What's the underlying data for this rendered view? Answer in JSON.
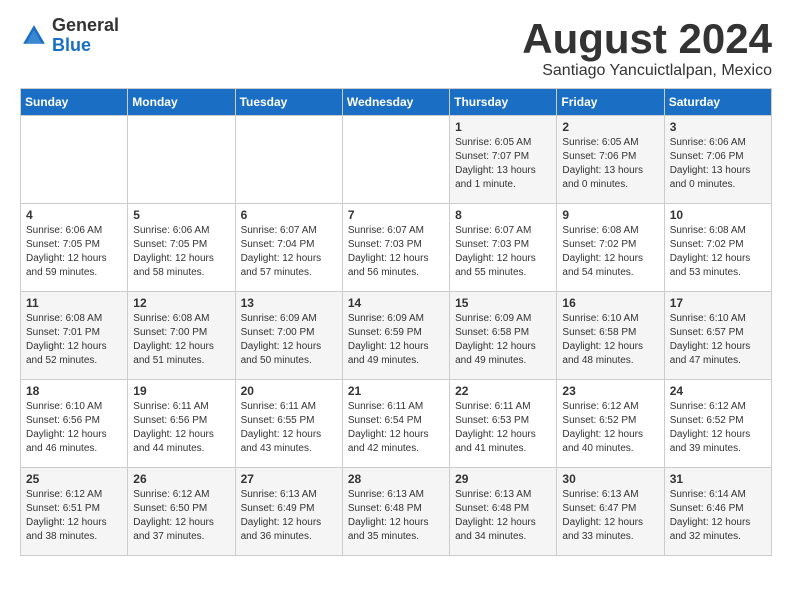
{
  "header": {
    "logo_general": "General",
    "logo_blue": "Blue",
    "month_title": "August 2024",
    "location": "Santiago Yancuictlalpan, Mexico"
  },
  "weekdays": [
    "Sunday",
    "Monday",
    "Tuesday",
    "Wednesday",
    "Thursday",
    "Friday",
    "Saturday"
  ],
  "weeks": [
    [
      {
        "day": "",
        "info": ""
      },
      {
        "day": "",
        "info": ""
      },
      {
        "day": "",
        "info": ""
      },
      {
        "day": "",
        "info": ""
      },
      {
        "day": "1",
        "info": "Sunrise: 6:05 AM\nSunset: 7:07 PM\nDaylight: 13 hours\nand 1 minute."
      },
      {
        "day": "2",
        "info": "Sunrise: 6:05 AM\nSunset: 7:06 PM\nDaylight: 13 hours\nand 0 minutes."
      },
      {
        "day": "3",
        "info": "Sunrise: 6:06 AM\nSunset: 7:06 PM\nDaylight: 13 hours\nand 0 minutes."
      }
    ],
    [
      {
        "day": "4",
        "info": "Sunrise: 6:06 AM\nSunset: 7:05 PM\nDaylight: 12 hours\nand 59 minutes."
      },
      {
        "day": "5",
        "info": "Sunrise: 6:06 AM\nSunset: 7:05 PM\nDaylight: 12 hours\nand 58 minutes."
      },
      {
        "day": "6",
        "info": "Sunrise: 6:07 AM\nSunset: 7:04 PM\nDaylight: 12 hours\nand 57 minutes."
      },
      {
        "day": "7",
        "info": "Sunrise: 6:07 AM\nSunset: 7:03 PM\nDaylight: 12 hours\nand 56 minutes."
      },
      {
        "day": "8",
        "info": "Sunrise: 6:07 AM\nSunset: 7:03 PM\nDaylight: 12 hours\nand 55 minutes."
      },
      {
        "day": "9",
        "info": "Sunrise: 6:08 AM\nSunset: 7:02 PM\nDaylight: 12 hours\nand 54 minutes."
      },
      {
        "day": "10",
        "info": "Sunrise: 6:08 AM\nSunset: 7:02 PM\nDaylight: 12 hours\nand 53 minutes."
      }
    ],
    [
      {
        "day": "11",
        "info": "Sunrise: 6:08 AM\nSunset: 7:01 PM\nDaylight: 12 hours\nand 52 minutes."
      },
      {
        "day": "12",
        "info": "Sunrise: 6:08 AM\nSunset: 7:00 PM\nDaylight: 12 hours\nand 51 minutes."
      },
      {
        "day": "13",
        "info": "Sunrise: 6:09 AM\nSunset: 7:00 PM\nDaylight: 12 hours\nand 50 minutes."
      },
      {
        "day": "14",
        "info": "Sunrise: 6:09 AM\nSunset: 6:59 PM\nDaylight: 12 hours\nand 49 minutes."
      },
      {
        "day": "15",
        "info": "Sunrise: 6:09 AM\nSunset: 6:58 PM\nDaylight: 12 hours\nand 49 minutes."
      },
      {
        "day": "16",
        "info": "Sunrise: 6:10 AM\nSunset: 6:58 PM\nDaylight: 12 hours\nand 48 minutes."
      },
      {
        "day": "17",
        "info": "Sunrise: 6:10 AM\nSunset: 6:57 PM\nDaylight: 12 hours\nand 47 minutes."
      }
    ],
    [
      {
        "day": "18",
        "info": "Sunrise: 6:10 AM\nSunset: 6:56 PM\nDaylight: 12 hours\nand 46 minutes."
      },
      {
        "day": "19",
        "info": "Sunrise: 6:11 AM\nSunset: 6:56 PM\nDaylight: 12 hours\nand 44 minutes."
      },
      {
        "day": "20",
        "info": "Sunrise: 6:11 AM\nSunset: 6:55 PM\nDaylight: 12 hours\nand 43 minutes."
      },
      {
        "day": "21",
        "info": "Sunrise: 6:11 AM\nSunset: 6:54 PM\nDaylight: 12 hours\nand 42 minutes."
      },
      {
        "day": "22",
        "info": "Sunrise: 6:11 AM\nSunset: 6:53 PM\nDaylight: 12 hours\nand 41 minutes."
      },
      {
        "day": "23",
        "info": "Sunrise: 6:12 AM\nSunset: 6:52 PM\nDaylight: 12 hours\nand 40 minutes."
      },
      {
        "day": "24",
        "info": "Sunrise: 6:12 AM\nSunset: 6:52 PM\nDaylight: 12 hours\nand 39 minutes."
      }
    ],
    [
      {
        "day": "25",
        "info": "Sunrise: 6:12 AM\nSunset: 6:51 PM\nDaylight: 12 hours\nand 38 minutes."
      },
      {
        "day": "26",
        "info": "Sunrise: 6:12 AM\nSunset: 6:50 PM\nDaylight: 12 hours\nand 37 minutes."
      },
      {
        "day": "27",
        "info": "Sunrise: 6:13 AM\nSunset: 6:49 PM\nDaylight: 12 hours\nand 36 minutes."
      },
      {
        "day": "28",
        "info": "Sunrise: 6:13 AM\nSunset: 6:48 PM\nDaylight: 12 hours\nand 35 minutes."
      },
      {
        "day": "29",
        "info": "Sunrise: 6:13 AM\nSunset: 6:48 PM\nDaylight: 12 hours\nand 34 minutes."
      },
      {
        "day": "30",
        "info": "Sunrise: 6:13 AM\nSunset: 6:47 PM\nDaylight: 12 hours\nand 33 minutes."
      },
      {
        "day": "31",
        "info": "Sunrise: 6:14 AM\nSunset: 6:46 PM\nDaylight: 12 hours\nand 32 minutes."
      }
    ]
  ]
}
